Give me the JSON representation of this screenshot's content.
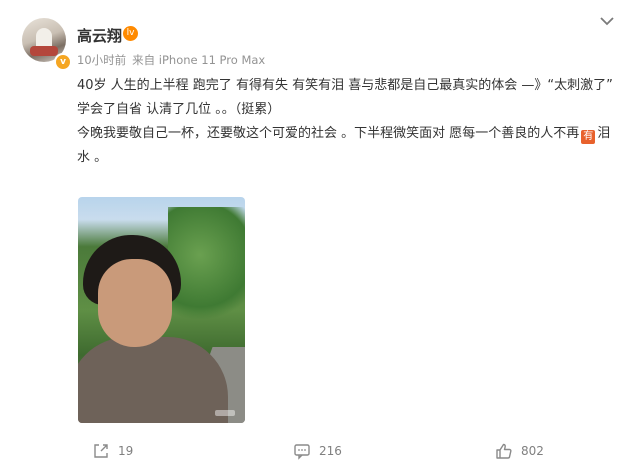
{
  "post": {
    "username": "高云翔",
    "level_badge": "lv",
    "verified_badge": "v",
    "time": "10小时前",
    "source": "来自 iPhone 11 Pro Max",
    "paragraphs": [
      "40岁 人生的上半程 跑完了 有得有失 有笑有泪 喜与悲都是自己最真实的体会 —》“太刺激了”",
      "学会了自省 认清了几位 。。（挺累）",
      "今晚我要敬自己一杯，还要敬这个可爱的社会 。下半程微笑面对 愿每一个善良的人不再"
    ],
    "last_line_tail": "泪水 。",
    "emoji_text": "有"
  },
  "actions": {
    "repost_count": "19",
    "comment_count": "216",
    "like_count": "802"
  },
  "colors": {
    "text": "#333333",
    "meta": "#939393",
    "action": "#808080",
    "verified": "#f5a623",
    "level": "#ff8a00"
  },
  "icons": [
    "chevron-down-icon",
    "verified-icon",
    "level-icon",
    "repost-icon",
    "comment-icon",
    "like-icon"
  ]
}
